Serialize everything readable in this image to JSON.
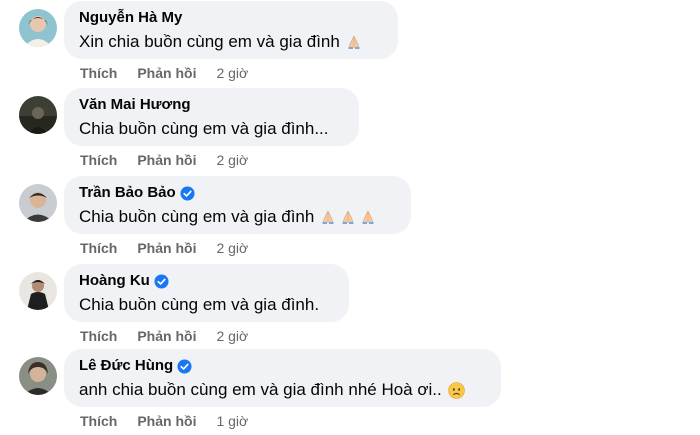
{
  "comments": [
    {
      "name": "Nguyễn Hà My",
      "verified": false,
      "text": "Xin chia buồn cùng em và gia đình",
      "emojis": [
        "folded-hands"
      ],
      "like": "Thích",
      "reply": "Phản hồi",
      "time": "2 giờ"
    },
    {
      "name": "Văn Mai Hương",
      "verified": false,
      "text": "Chia buồn cùng em và gia đình...",
      "emojis": [],
      "like": "Thích",
      "reply": "Phản hồi",
      "time": "2 giờ"
    },
    {
      "name": "Trần Bảo Bảo",
      "verified": true,
      "text": "Chia buồn cùng em và gia đình",
      "emojis": [
        "folded-hands",
        "folded-hands",
        "folded-hands"
      ],
      "like": "Thích",
      "reply": "Phản hồi",
      "time": "2 giờ"
    },
    {
      "name": "Hoàng Ku",
      "verified": true,
      "text": "Chia buồn cùng em và gia đình.",
      "emojis": [],
      "like": "Thích",
      "reply": "Phản hồi",
      "time": "2 giờ"
    },
    {
      "name": "Lê Đức Hùng",
      "verified": true,
      "text": "anh chia buồn cùng em và gia đình nhé Hoà ơi..",
      "emojis": [
        "sad-face"
      ],
      "like": "Thích",
      "reply": "Phản hồi",
      "time": "1 giờ"
    }
  ],
  "colors": {
    "bubble": "#f0f2f5",
    "meta": "#65676b",
    "verified": "#1877f2"
  }
}
